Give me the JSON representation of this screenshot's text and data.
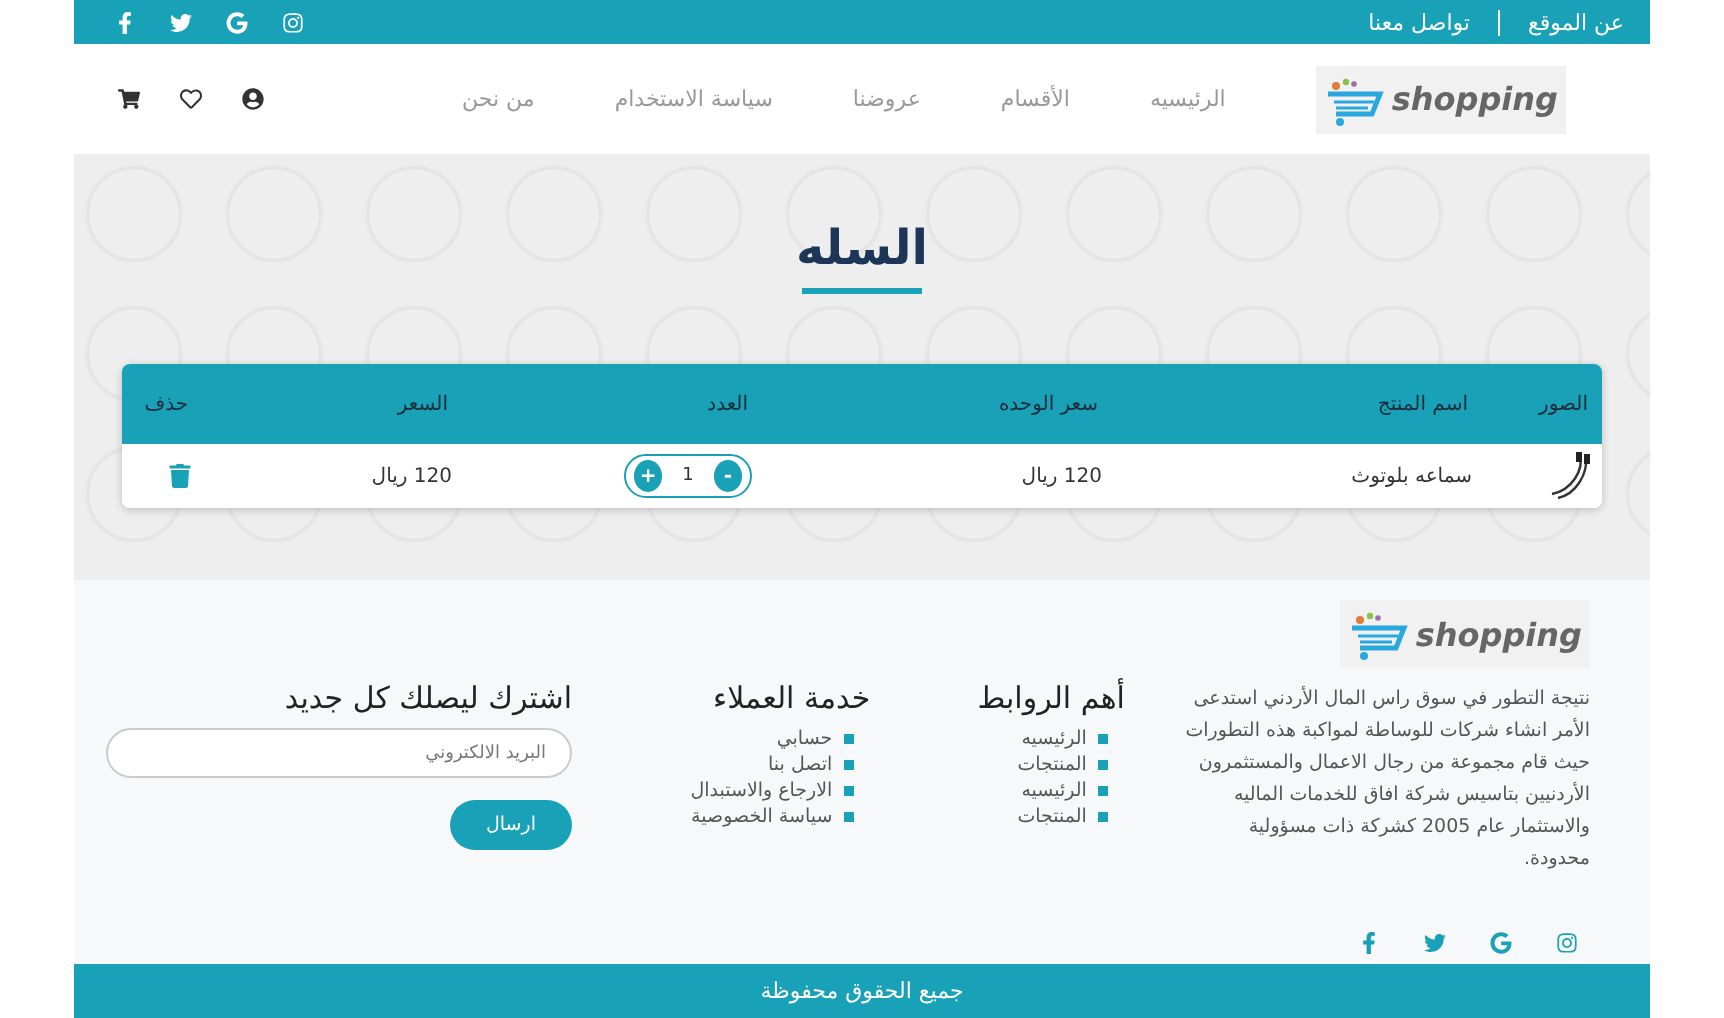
{
  "top_bar": {
    "links": [
      "عن الموقع",
      "تواصل معنا"
    ]
  },
  "header": {
    "logo": "shopping",
    "nav": [
      "الرئيسيه",
      "الأقسام",
      "عروضنا",
      "سياسة الاستخدام",
      "من نحن"
    ]
  },
  "page_title": "السله",
  "cart_table": {
    "columns": [
      "الصور",
      "اسم المنتج",
      "سعر الوحده",
      "العدد",
      "السعر",
      "حذف"
    ],
    "rows": [
      {
        "product": "سماعه بلوتوث",
        "unit_price": "120 ريال",
        "decrement": "-",
        "quantity": "1",
        "increment": "+",
        "price": "120 ريال"
      }
    ]
  },
  "footer": {
    "logo": "shopping",
    "about": "نتيجة التطور في سوق راس المال الأردني استدعى الأمر انشاء شركات للوساطة لمواكبة هذه التطورات حيث قام مجموعة من رجال الاعمال والمستثمرون الأردنيين بتاسيس شركة افاق للخدمات الماليه والاستثمار عام 2005 كشركة ذات مسؤولية محدودة.",
    "links": {
      "title": "أهم الروابط",
      "items": [
        "الرئيسيه",
        "المنتجات",
        "الرئيسيه",
        "المنتجات"
      ]
    },
    "service": {
      "title": "خدمة العملاء",
      "items": [
        "حسابي",
        "اتصل بنا",
        "الارجاع والاستبدال",
        "سياسة الخصوصية"
      ]
    },
    "subscribe": {
      "title": "اشترك ليصلك كل جديد",
      "placeholder": "البريد الالكتروني",
      "button": "ارسال"
    }
  },
  "copyright": "جميع الحقوق محفوظة"
}
